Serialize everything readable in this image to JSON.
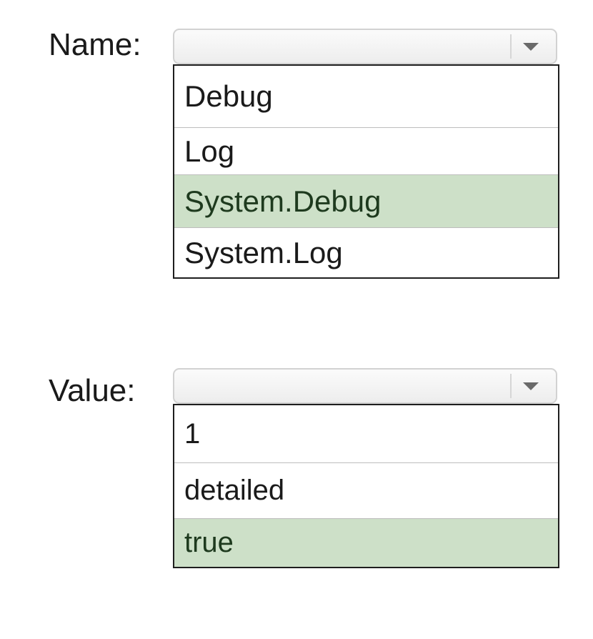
{
  "name_field": {
    "label": "Name:",
    "value": "",
    "options": [
      "Debug",
      "Log",
      "System.Debug",
      "System.Log"
    ],
    "highlighted": "System.Debug"
  },
  "value_field": {
    "label": "Value:",
    "value": "",
    "options": [
      "1",
      "detailed",
      "true"
    ],
    "highlighted": "true"
  },
  "colors": {
    "highlight": "#cde0c8",
    "list_border": "#1e1e1e",
    "combo_border": "#d2d2d2"
  },
  "icons": {
    "combo_arrow": "chevron-down-icon"
  }
}
